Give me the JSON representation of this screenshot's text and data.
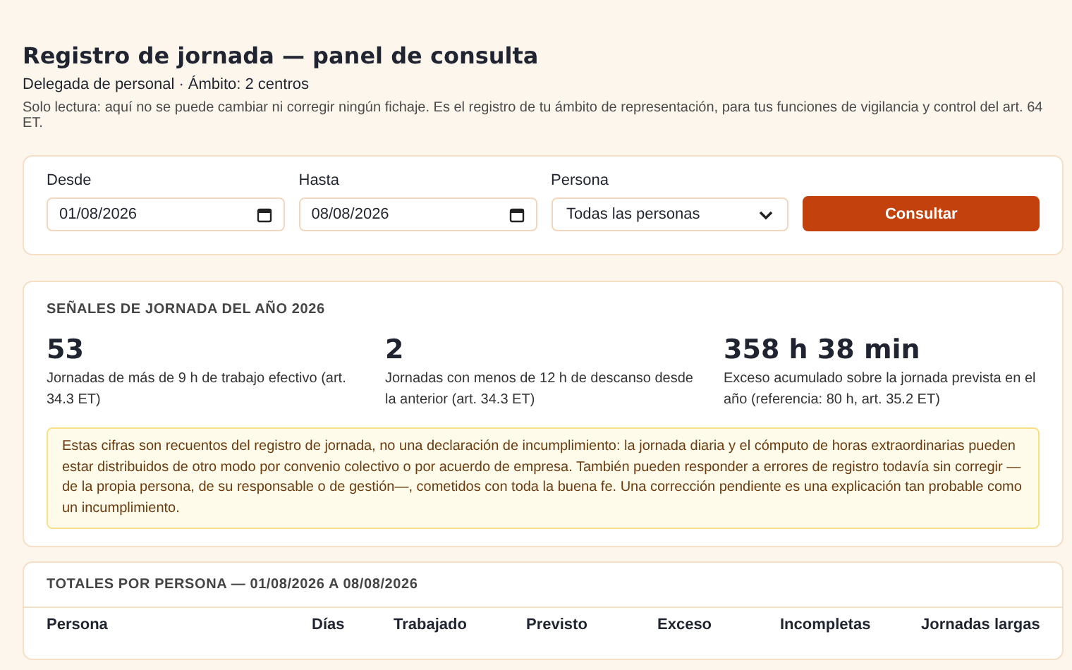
{
  "header": {
    "title": "Registro de jornada — panel de consulta",
    "subtitle": "Delegada de personal · Ámbito: 2 centros",
    "note": "Solo lectura: aquí no se puede cambiar ni corregir ningún fichaje. Es el registro de tu ámbito de representación, para tus funciones de vigilancia y control del art. 64 ET."
  },
  "filters": {
    "fields": [
      {
        "kind": "date",
        "label": "Desde",
        "value": "01/08/2026"
      },
      {
        "kind": "date",
        "label": "Hasta",
        "value": "08/08/2026"
      },
      {
        "kind": "select",
        "label": "Persona",
        "value": "Todas las personas"
      }
    ],
    "button": "Consultar"
  },
  "signals": {
    "title": "SEÑALES DE JORNADA DEL AÑO 2026",
    "items": [
      {
        "value": "53",
        "caption": "Jornadas de más de 9 h de trabajo efectivo (art. 34.3 ET)"
      },
      {
        "value": "2",
        "caption": "Jornadas con menos de 12 h de descanso desde la anterior (art. 34.3 ET)"
      },
      {
        "value": "358 h 38 min",
        "caption": "Exceso acumulado sobre la jornada prevista en el año (referencia: 80 h, art. 35.2 ET)"
      }
    ],
    "notice": "Estas cifras son recuentos del registro de jornada, no una declaración de incumplimiento: la jornada diaria y el cómputo de horas extraordinarias pueden estar distribuidos de otro modo por convenio colectivo o por acuerdo de empresa. También pueden responder a errores de registro todavía sin corregir —de la propia persona, de su responsable o de gestión—, cometidos con toda la buena fe. Una corrección pendiente es una explicación tan probable como un incumplimiento."
  },
  "totals": {
    "title": "TOTALES POR PERSONA — 01/08/2026 A 08/08/2026",
    "columns": [
      "Persona",
      "Días",
      "Trabajado",
      "Previsto",
      "Exceso",
      "Incompletas",
      "Jornadas largas"
    ]
  }
}
